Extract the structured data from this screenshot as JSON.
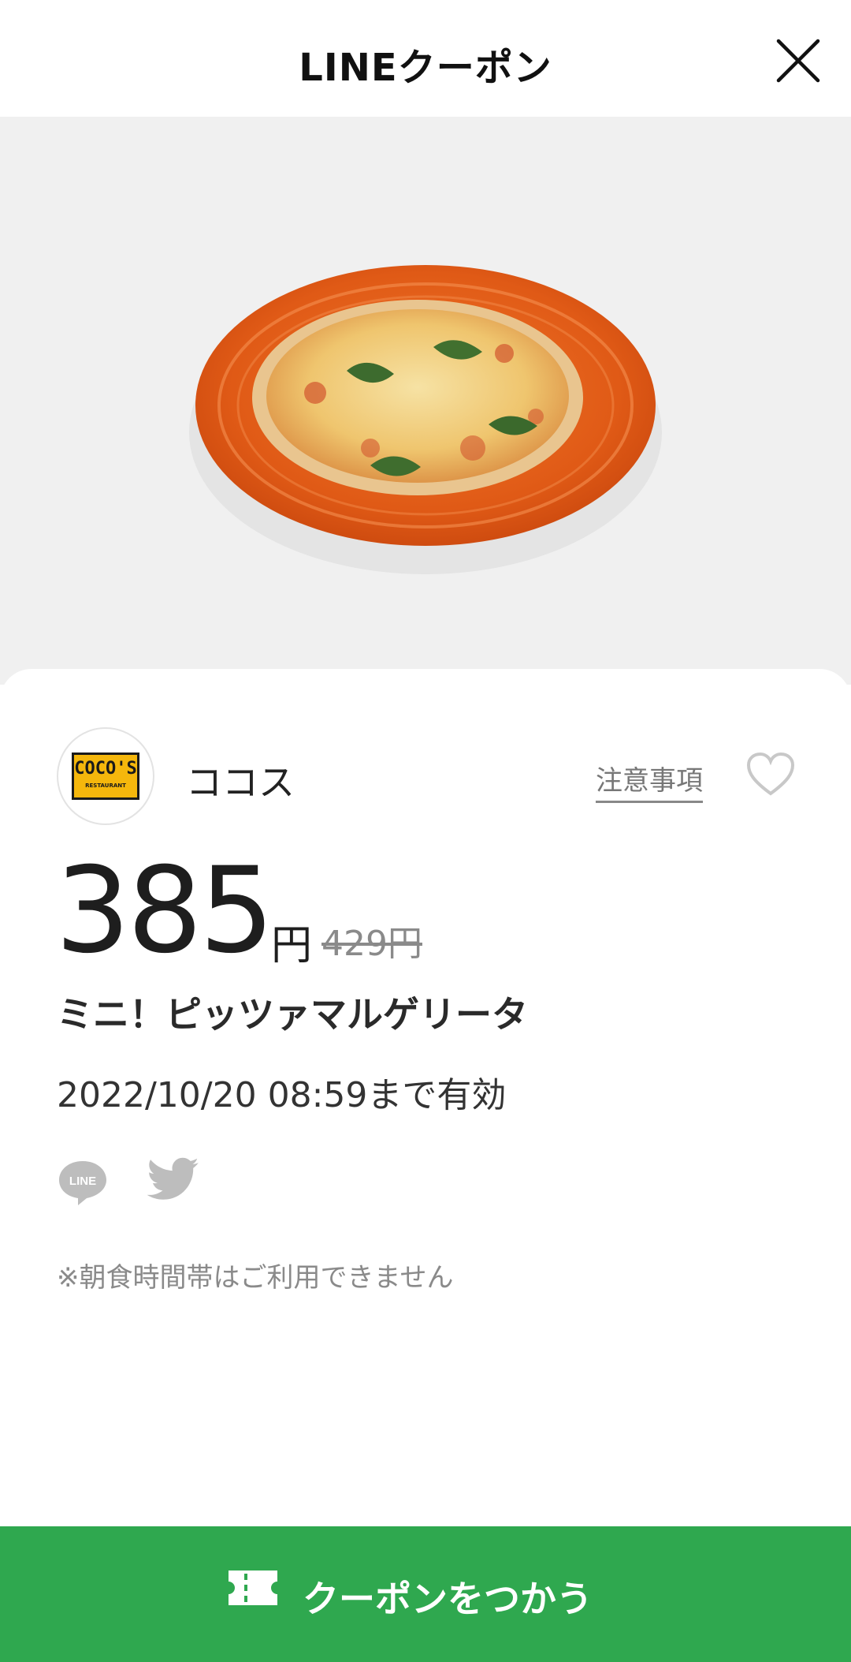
{
  "header": {
    "title": "LINEクーポン",
    "close_icon": "close-icon"
  },
  "store": {
    "name": "ココス",
    "logo_text": "COCO'S",
    "logo_subtext": "RESTAURANT",
    "notes_label": "注意事項",
    "favorite_icon": "heart-outline-icon"
  },
  "coupon": {
    "price": "385",
    "unit": "円",
    "original_price": "429円",
    "item_name": "ミニ！ピッツァマルゲリータ",
    "expiry": "2022/10/20  08:59まで有効",
    "note": "※朝食時間帯はご利用できません"
  },
  "share": {
    "line_icon": "line-share-icon",
    "twitter_icon": "twitter-icon"
  },
  "action": {
    "label": "クーポンをつかう",
    "icon": "ticket-icon"
  },
  "colors": {
    "accent": "#2fa84f",
    "hero_bg": "#f0f0f0",
    "plate": "#e2631c"
  }
}
